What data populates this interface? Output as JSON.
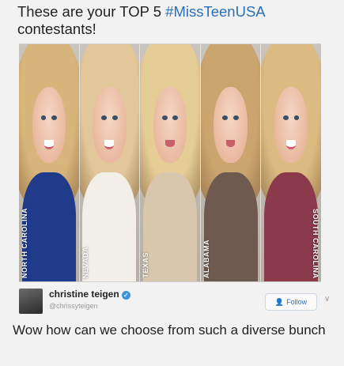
{
  "headline": {
    "prefix": "These are your TOP 5 ",
    "hashtag": "#MissTeenUSA",
    "suffix": " contestants!"
  },
  "photo": {
    "contestants": [
      {
        "state": "NORTH CAROLINA",
        "label_side": "left",
        "hair": "#d8b57a",
        "dress": "#1f3b8a",
        "mouth": "smile"
      },
      {
        "state": "NEVADA",
        "label_side": "left",
        "hair": "#e2c79a",
        "dress": "#f2eee8",
        "mouth": "smile"
      },
      {
        "state": "TEXAS",
        "label_side": "left",
        "hair": "#e6cd95",
        "dress": "#d9c7ad",
        "mouth": "closed"
      },
      {
        "state": "ALABAMA",
        "label_side": "left",
        "hair": "#cba56e",
        "dress": "#6f5a4f",
        "mouth": "closed"
      },
      {
        "state": "SOUTH CAROLINA",
        "label_side": "right",
        "hair": "#dcbb82",
        "dress": "#8a3a4a",
        "mouth": "smile"
      }
    ]
  },
  "author": {
    "name": "christine teigen",
    "handle": "@chrissyteigen",
    "follow_label": "Follow",
    "verified_icon": "✓"
  },
  "tweet": {
    "text": "Wow how can we choose from such a diverse bunch"
  },
  "colors": {
    "hashtag": "#2a6fb8",
    "verified": "#3b94d9",
    "background": "#f2f2f2"
  }
}
